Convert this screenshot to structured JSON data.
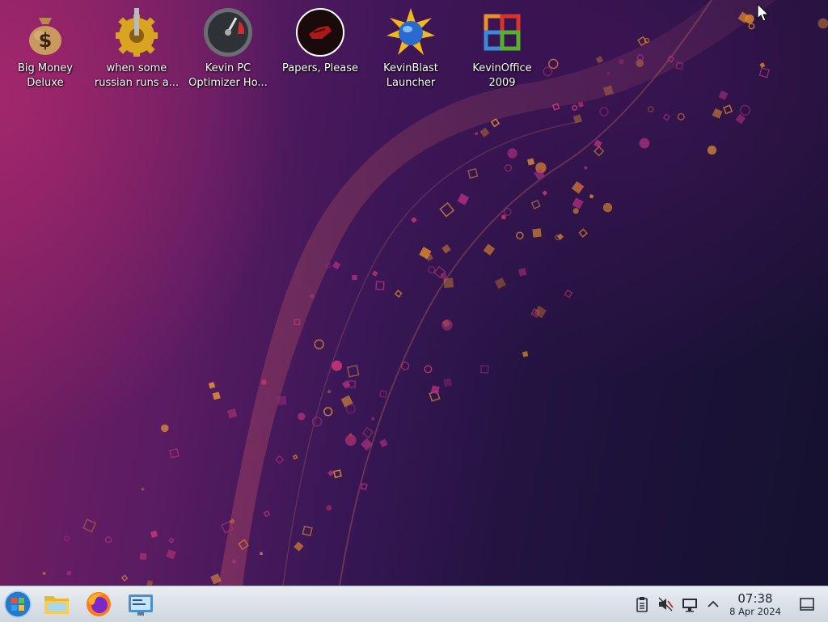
{
  "desktop": {
    "icons": [
      {
        "label": "Big Money\nDeluxe",
        "icon": "money-bag-icon"
      },
      {
        "label": "when some\nrussian runs a...",
        "icon": "gear-icon"
      },
      {
        "label": "Kevin PC\nOptimizer Ho...",
        "icon": "speedometer-icon"
      },
      {
        "label": "Papers, Please",
        "icon": "papers-please-icon"
      },
      {
        "label": "KevinBlast\nLauncher",
        "icon": "globe-burst-icon"
      },
      {
        "label": "KevinOffice\n2009",
        "icon": "office-logo-icon"
      }
    ]
  },
  "taskbar": {
    "pinned": [
      "start-menu-icon",
      "file-manager-icon",
      "firefox-icon",
      "system-settings-icon"
    ],
    "tray": [
      "clipboard-icon",
      "volume-muted-icon",
      "display-icon",
      "expand-tray-icon"
    ],
    "clock": {
      "time": "07:38",
      "date": "8 Apr 2024"
    },
    "show_desktop": "show-desktop-icon"
  },
  "colors": {
    "wallpaper_left": "#7a1f60",
    "wallpaper_right": "#16112f",
    "particle_orange": "#e08a2a",
    "particle_magenta": "#d63a7a",
    "taskbar_bg": "#dde3ea"
  }
}
